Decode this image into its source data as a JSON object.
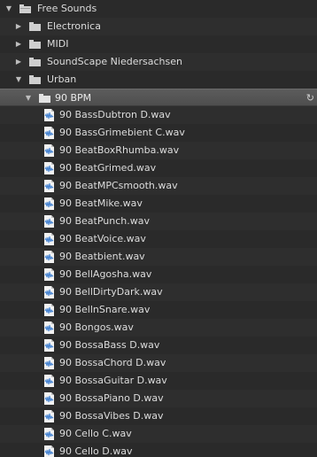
{
  "tree": {
    "root": {
      "label": "Free Sounds",
      "expanded": true
    },
    "folders": [
      {
        "label": "Electronica",
        "expanded": false
      },
      {
        "label": "MIDI",
        "expanded": false
      },
      {
        "label": "SoundScape Niedersachsen",
        "expanded": false
      },
      {
        "label": "Urban",
        "expanded": true
      }
    ],
    "subfolder": {
      "label": "90 BPM",
      "expanded": true,
      "refresh_icon": "refresh-icon"
    },
    "files": [
      "90 BassDubtron D.wav",
      "90 BassGrimebient C.wav",
      "90 BeatBoxRhumba.wav",
      "90 BeatGrimed.wav",
      "90 BeatMPCsmooth.wav",
      "90 BeatMike.wav",
      "90 BeatPunch.wav",
      "90 BeatVoice.wav",
      "90 Beatbient.wav",
      "90 BellAgosha.wav",
      "90 BellDirtyDark.wav",
      "90 BellnSnare.wav",
      "90 Bongos.wav",
      "90 BossaBass D.wav",
      "90 BossaChord D.wav",
      "90 BossaGuitar D.wav",
      "90 BossaPiano D.wav",
      "90 BossaVibes D.wav",
      "90 Cello C.wav",
      "90 Cello D.wav"
    ]
  },
  "colors": {
    "background": "#2b2b2b",
    "selected_row": "#555555",
    "text": "#dcdcdc",
    "file_icon_wave": "#3f7fd0"
  }
}
